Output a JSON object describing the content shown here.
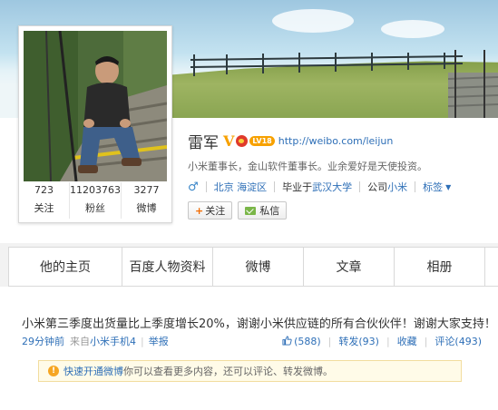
{
  "profile": {
    "name": "雷军",
    "verified_badge": "V",
    "level_badge": "LV18",
    "home_url": "http://weibo.com/leijun",
    "bio": "小米董事长，金山软件董事长。业余爱好是天使投资。",
    "location": "北京 海淀区",
    "school_prefix": "毕业于",
    "school": "武汉大学",
    "company_prefix": "公司",
    "company": "小米",
    "tags_label": "标签",
    "follow_label": "关注",
    "message_label": "私信",
    "stats": [
      {
        "value": "723",
        "label": "关注"
      },
      {
        "value": "11203763",
        "label": "粉丝"
      },
      {
        "value": "3277",
        "label": "微博"
      }
    ]
  },
  "tabs": [
    {
      "label": "他的主页"
    },
    {
      "label": "百度人物资料"
    },
    {
      "label": "微博"
    },
    {
      "label": "文章"
    },
    {
      "label": "相册"
    }
  ],
  "post": {
    "text": "小米第三季度出货量比上季度增长20%，谢谢小米供应链的所有合伙伙伴！谢谢大家支持！",
    "time": "29分钟前",
    "source_prefix": "来自",
    "source": "小米手机4",
    "report": "举报",
    "likes": "(588)",
    "forward": "转发(93)",
    "favorite": "收藏",
    "comment": "评论(493)"
  },
  "notice": {
    "link": "快速开通微博",
    "text": "你可以查看更多内容，还可以评论、转发微博。"
  },
  "colors": {
    "link_blue": "#2e6fb7",
    "active_tab": "#ff8140",
    "notice_bg": "#fffbe8"
  }
}
